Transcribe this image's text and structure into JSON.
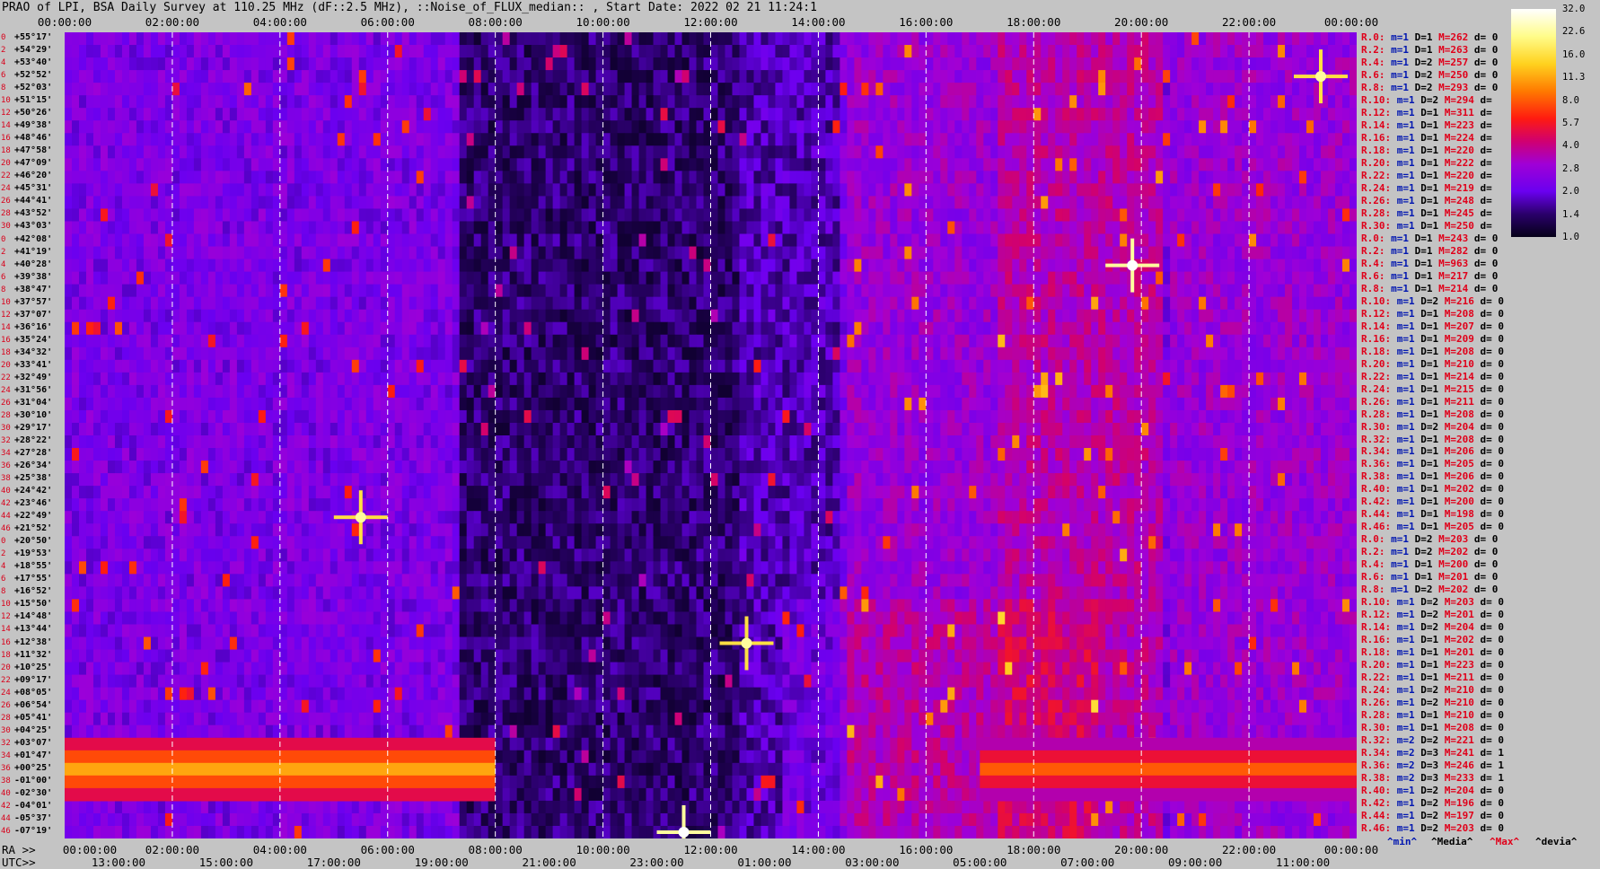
{
  "title": "PRAO of LPI, BSA Daily Survey at 110.25 MHz (dF::2.5 MHz), ::Noise_of_FLUX_median:: , Start Date: 2022 02 21 11:24:1",
  "top_ticks": [
    "00:00:00",
    "02:00:00",
    "04:00:00",
    "06:00:00",
    "08:00:00",
    "10:00:00",
    "12:00:00",
    "14:00:00",
    "16:00:00",
    "18:00:00",
    "20:00:00",
    "22:00:00",
    "00:00:00"
  ],
  "ra_prefix": "RA >>",
  "ra_ticks": [
    "00:00:00",
    "02:00:00",
    "04:00:00",
    "06:00:00",
    "08:00:00",
    "10:00:00",
    "12:00:00",
    "14:00:00",
    "16:00:00",
    "18:00:00",
    "20:00:00",
    "22:00:00",
    "00:00:00"
  ],
  "utc_prefix": "UTC>>",
  "utc_ticks": [
    "13:00:00",
    "15:00:00",
    "17:00:00",
    "19:00:00",
    "21:00:00",
    "23:00:00",
    "01:00:00",
    "03:00:00",
    "05:00:00",
    "07:00:00",
    "09:00:00",
    "11:00:00"
  ],
  "declinations": [
    "+55°17'",
    "+54°29'",
    "+53°40'",
    "+52°52'",
    "+52°03'",
    "+51°15'",
    "+50°26'",
    "+49°38'",
    "+48°46'",
    "+47°58'",
    "+47°09'",
    "+46°20'",
    "+45°31'",
    "+44°41'",
    "+43°52'",
    "+43°03'",
    "+42°08'",
    "+41°19'",
    "+40°28'",
    "+39°38'",
    "+38°47'",
    "+37°57'",
    "+37°07'",
    "+36°16'",
    "+35°24'",
    "+34°32'",
    "+33°41'",
    "+32°49'",
    "+31°56'",
    "+31°04'",
    "+30°10'",
    "+29°17'",
    "+28°22'",
    "+27°28'",
    "+26°34'",
    "+25°38'",
    "+24°42'",
    "+23°46'",
    "+22°49'",
    "+21°52'",
    "+20°50'",
    "+19°53'",
    "+18°55'",
    "+17°55'",
    "+16°52'",
    "+15°50'",
    "+14°48'",
    "+13°44'",
    "+12°38'",
    "+11°32'",
    "+10°25'",
    "+09°17'",
    "+08°05'",
    "+06°54'",
    "+05°41'",
    "+04°25'",
    "+03°07'",
    "+01°47'",
    "+00°25'",
    "-01°00'",
    "-02°30'",
    "-04°01'",
    "-05°37'",
    "-07°19'"
  ],
  "row_indices": [
    "0",
    "2",
    "4",
    "6",
    "8",
    "10",
    "12",
    "14",
    "16",
    "18",
    "20",
    "22",
    "24",
    "26",
    "28",
    "30",
    "0",
    "2",
    "4",
    "6",
    "8",
    "10",
    "12",
    "14",
    "16",
    "18",
    "20",
    "22",
    "24",
    "26",
    "28",
    "30",
    "32",
    "34",
    "36",
    "38",
    "40",
    "42",
    "44",
    "46",
    "0",
    "2",
    "4",
    "6",
    "8",
    "10",
    "12",
    "14",
    "16",
    "18",
    "20",
    "22",
    "24",
    "26",
    "28",
    "30",
    "32",
    "34",
    "36",
    "38",
    "40",
    "42",
    "44",
    "46"
  ],
  "stats": [
    {
      "r": "R.0:",
      "m": "m=1",
      "D": "D=1",
      "M": "M=262",
      "d": "d= 0"
    },
    {
      "r": "R.2:",
      "m": "m=1",
      "D": "D=1",
      "M": "M=263",
      "d": "d= 0"
    },
    {
      "r": "R.4:",
      "m": "m=1",
      "D": "D=2",
      "M": "M=257",
      "d": "d= 0"
    },
    {
      "r": "R.6:",
      "m": "m=1",
      "D": "D=2",
      "M": "M=250",
      "d": "d= 0"
    },
    {
      "r": "R.8:",
      "m": "m=1",
      "D": "D=2",
      "M": "M=293",
      "d": "d= 0"
    },
    {
      "r": "R.10:",
      "m": "m=1",
      "D": "D=2",
      "M": "M=294",
      "d": "d="
    },
    {
      "r": "R.12:",
      "m": "m=1",
      "D": "D=1",
      "M": "M=311",
      "d": "d="
    },
    {
      "r": "R.14:",
      "m": "m=1",
      "D": "D=1",
      "M": "M=223",
      "d": "d="
    },
    {
      "r": "R.16:",
      "m": "m=1",
      "D": "D=1",
      "M": "M=224",
      "d": "d="
    },
    {
      "r": "R.18:",
      "m": "m=1",
      "D": "D=1",
      "M": "M=220",
      "d": "d="
    },
    {
      "r": "R.20:",
      "m": "m=1",
      "D": "D=1",
      "M": "M=222",
      "d": "d="
    },
    {
      "r": "R.22:",
      "m": "m=1",
      "D": "D=1",
      "M": "M=220",
      "d": "d="
    },
    {
      "r": "R.24:",
      "m": "m=1",
      "D": "D=1",
      "M": "M=219",
      "d": "d="
    },
    {
      "r": "R.26:",
      "m": "m=1",
      "D": "D=1",
      "M": "M=248",
      "d": "d="
    },
    {
      "r": "R.28:",
      "m": "m=1",
      "D": "D=1",
      "M": "M=245",
      "d": "d="
    },
    {
      "r": "R.30:",
      "m": "m=1",
      "D": "D=1",
      "M": "M=250",
      "d": "d="
    },
    {
      "r": "R.0:",
      "m": "m=1",
      "D": "D=1",
      "M": "M=243",
      "d": "d= 0"
    },
    {
      "r": "R.2:",
      "m": "m=1",
      "D": "D=1",
      "M": "M=282",
      "d": "d= 0"
    },
    {
      "r": "R.4:",
      "m": "m=1",
      "D": "D=1",
      "M": "M=963",
      "d": "d= 0"
    },
    {
      "r": "R.6:",
      "m": "m=1",
      "D": "D=1",
      "M": "M=217",
      "d": "d= 0"
    },
    {
      "r": "R.8:",
      "m": "m=1",
      "D": "D=1",
      "M": "M=214",
      "d": "d= 0"
    },
    {
      "r": "R.10:",
      "m": "m=1",
      "D": "D=2",
      "M": "M=216",
      "d": "d= 0"
    },
    {
      "r": "R.12:",
      "m": "m=1",
      "D": "D=1",
      "M": "M=208",
      "d": "d= 0"
    },
    {
      "r": "R.14:",
      "m": "m=1",
      "D": "D=1",
      "M": "M=207",
      "d": "d= 0"
    },
    {
      "r": "R.16:",
      "m": "m=1",
      "D": "D=1",
      "M": "M=209",
      "d": "d= 0"
    },
    {
      "r": "R.18:",
      "m": "m=1",
      "D": "D=1",
      "M": "M=208",
      "d": "d= 0"
    },
    {
      "r": "R.20:",
      "m": "m=1",
      "D": "D=1",
      "M": "M=210",
      "d": "d= 0"
    },
    {
      "r": "R.22:",
      "m": "m=1",
      "D": "D=1",
      "M": "M=214",
      "d": "d= 0"
    },
    {
      "r": "R.24:",
      "m": "m=1",
      "D": "D=1",
      "M": "M=215",
      "d": "d= 0"
    },
    {
      "r": "R.26:",
      "m": "m=1",
      "D": "D=1",
      "M": "M=211",
      "d": "d= 0"
    },
    {
      "r": "R.28:",
      "m": "m=1",
      "D": "D=1",
      "M": "M=208",
      "d": "d= 0"
    },
    {
      "r": "R.30:",
      "m": "m=1",
      "D": "D=2",
      "M": "M=204",
      "d": "d= 0"
    },
    {
      "r": "R.32:",
      "m": "m=1",
      "D": "D=1",
      "M": "M=208",
      "d": "d= 0"
    },
    {
      "r": "R.34:",
      "m": "m=1",
      "D": "D=1",
      "M": "M=206",
      "d": "d= 0"
    },
    {
      "r": "R.36:",
      "m": "m=1",
      "D": "D=1",
      "M": "M=205",
      "d": "d= 0"
    },
    {
      "r": "R.38:",
      "m": "m=1",
      "D": "D=1",
      "M": "M=206",
      "d": "d= 0"
    },
    {
      "r": "R.40:",
      "m": "m=1",
      "D": "D=1",
      "M": "M=202",
      "d": "d= 0"
    },
    {
      "r": "R.42:",
      "m": "m=1",
      "D": "D=1",
      "M": "M=200",
      "d": "d= 0"
    },
    {
      "r": "R.44:",
      "m": "m=1",
      "D": "D=1",
      "M": "M=198",
      "d": "d= 0"
    },
    {
      "r": "R.46:",
      "m": "m=1",
      "D": "D=1",
      "M": "M=205",
      "d": "d= 0"
    },
    {
      "r": "R.0:",
      "m": "m=1",
      "D": "D=2",
      "M": "M=203",
      "d": "d= 0"
    },
    {
      "r": "R.2:",
      "m": "m=1",
      "D": "D=2",
      "M": "M=202",
      "d": "d= 0"
    },
    {
      "r": "R.4:",
      "m": "m=1",
      "D": "D=1",
      "M": "M=200",
      "d": "d= 0"
    },
    {
      "r": "R.6:",
      "m": "m=1",
      "D": "D=1",
      "M": "M=201",
      "d": "d= 0"
    },
    {
      "r": "R.8:",
      "m": "m=1",
      "D": "D=2",
      "M": "M=202",
      "d": "d= 0"
    },
    {
      "r": "R.10:",
      "m": "m=1",
      "D": "D=2",
      "M": "M=203",
      "d": "d= 0"
    },
    {
      "r": "R.12:",
      "m": "m=1",
      "D": "D=2",
      "M": "M=201",
      "d": "d= 0"
    },
    {
      "r": "R.14:",
      "m": "m=1",
      "D": "D=2",
      "M": "M=204",
      "d": "d= 0"
    },
    {
      "r": "R.16:",
      "m": "m=1",
      "D": "D=1",
      "M": "M=202",
      "d": "d= 0"
    },
    {
      "r": "R.18:",
      "m": "m=1",
      "D": "D=1",
      "M": "M=201",
      "d": "d= 0"
    },
    {
      "r": "R.20:",
      "m": "m=1",
      "D": "D=1",
      "M": "M=223",
      "d": "d= 0"
    },
    {
      "r": "R.22:",
      "m": "m=1",
      "D": "D=1",
      "M": "M=211",
      "d": "d= 0"
    },
    {
      "r": "R.24:",
      "m": "m=1",
      "D": "D=2",
      "M": "M=210",
      "d": "d= 0"
    },
    {
      "r": "R.26:",
      "m": "m=1",
      "D": "D=2",
      "M": "M=210",
      "d": "d= 0"
    },
    {
      "r": "R.28:",
      "m": "m=1",
      "D": "D=1",
      "M": "M=210",
      "d": "d= 0"
    },
    {
      "r": "R.30:",
      "m": "m=1",
      "D": "D=1",
      "M": "M=208",
      "d": "d= 0"
    },
    {
      "r": "R.32:",
      "m": "m=2",
      "D": "D=2",
      "M": "M=221",
      "d": "d= 0"
    },
    {
      "r": "R.34:",
      "m": "m=2",
      "D": "D=3",
      "M": "M=241",
      "d": "d= 1"
    },
    {
      "r": "R.36:",
      "m": "m=2",
      "D": "D=3",
      "M": "M=246",
      "d": "d= 1"
    },
    {
      "r": "R.38:",
      "m": "m=2",
      "D": "D=3",
      "M": "M=233",
      "d": "d= 1"
    },
    {
      "r": "R.40:",
      "m": "m=1",
      "D": "D=2",
      "M": "M=204",
      "d": "d= 0"
    },
    {
      "r": "R.42:",
      "m": "m=1",
      "D": "D=2",
      "M": "M=196",
      "d": "d= 0"
    },
    {
      "r": "R.44:",
      "m": "m=1",
      "D": "D=2",
      "M": "M=197",
      "d": "d= 0"
    },
    {
      "r": "R.46:",
      "m": "m=1",
      "D": "D=2",
      "M": "M=203",
      "d": "d= 0"
    }
  ],
  "legend": {
    "min": "^min^",
    "media": "^Media^",
    "max": "^Max^",
    "devia": "^devia^"
  },
  "colorbar_labels": [
    "32.0",
    "22.6",
    "16.0",
    "11.3",
    "8.0",
    "5.7",
    "4.0",
    "2.8",
    "2.0",
    "1.4",
    "1.0"
  ],
  "colors": {
    "min": "#0016b0",
    "media": "#000000",
    "max": "#e0001a",
    "devia": "#000000"
  },
  "chart_data": {
    "type": "heatmap",
    "title": "PRAO of LPI, BSA Daily Survey at 110.25 MHz (dF::2.5 MHz), ::Noise_of_FLUX_median:: , Start Date: 2022 02 21 11:24:1",
    "x_axis": "RA",
    "x_range": [
      "00:00:00",
      "24:00:00"
    ],
    "y_axis": "declination",
    "y_range": [
      "+55°17'",
      "-07°19'"
    ],
    "color_scale": {
      "min": 1.0,
      "max": 32.0,
      "scale": "log2"
    },
    "features": [
      {
        "kind": "band",
        "dec": "+00°25'",
        "ra_from": "00:00:00",
        "ra_to": "08:00:00",
        "level": 11.3
      },
      {
        "kind": "band",
        "dec": "+00°25'",
        "ra_from": "17:00:00",
        "ra_to": "24:00:00",
        "level": 8.0
      },
      {
        "kind": "source",
        "ra": "19:50:00",
        "dec": "+40°28'",
        "level": 32.0
      },
      {
        "kind": "source",
        "ra": "23:20:00",
        "dec": "+52°52'",
        "level": 22.6
      },
      {
        "kind": "source",
        "ra": "05:30:00",
        "dec": "+22°49'",
        "level": 22.6
      },
      {
        "kind": "source",
        "ra": "12:40:00",
        "dec": "+12°38'",
        "level": 22.6
      },
      {
        "kind": "source",
        "ra": "11:30:00",
        "dec": "-07°19'",
        "level": 32.0
      }
    ]
  }
}
